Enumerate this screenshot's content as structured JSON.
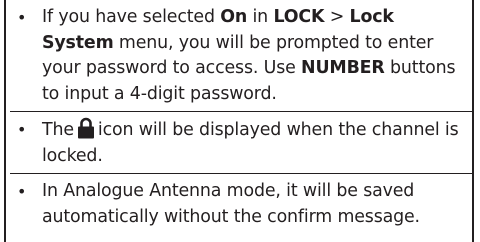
{
  "notes": [
    {
      "bullet": "•",
      "parts": [
        "If you have selected ",
        "On",
        " in ",
        "LOCK",
        " > ",
        "Lock System",
        " menu, you will be prompted to enter your password to access. Use ",
        "NUMBER",
        " buttons to input a 4-digit password."
      ]
    },
    {
      "bullet": "•",
      "before_icon": "The",
      "icon": "padlock-icon",
      "after_icon": "icon will be displayed when the channel is locked."
    },
    {
      "bullet": "•",
      "text": "In Analogue Antenna mode, it will be saved automatically without the confirm message."
    }
  ]
}
